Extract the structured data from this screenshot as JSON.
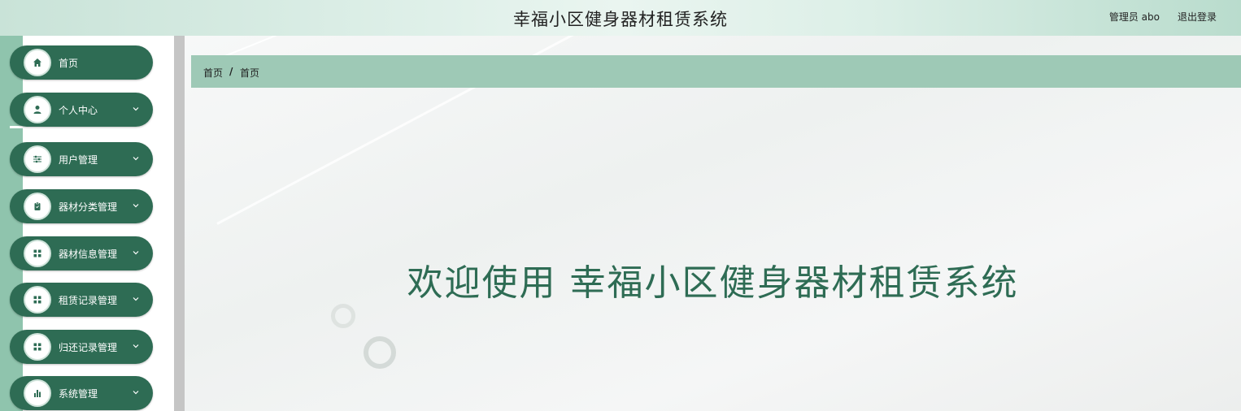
{
  "header": {
    "title": "幸福小区健身器材租赁系统",
    "user_label": "管理员 abo",
    "logout_label": "退出登录"
  },
  "sidebar": {
    "items": [
      {
        "label": "首页",
        "icon": "home-icon",
        "has_chevron": false
      },
      {
        "label": "个人中心",
        "icon": "person-icon",
        "has_chevron": true
      },
      {
        "label": "用户管理",
        "icon": "sliders-icon",
        "has_chevron": true
      },
      {
        "label": "器材分类管理",
        "icon": "clipboard-icon",
        "has_chevron": true
      },
      {
        "label": "器材信息管理",
        "icon": "grid-icon",
        "has_chevron": true
      },
      {
        "label": "租赁记录管理",
        "icon": "grid-icon",
        "has_chevron": true
      },
      {
        "label": "归还记录管理",
        "icon": "grid-icon",
        "has_chevron": true
      },
      {
        "label": "系统管理",
        "icon": "bar-chart-icon",
        "has_chevron": true
      }
    ]
  },
  "breadcrumb": {
    "first": "首页",
    "separator": "/",
    "current": "首页"
  },
  "main": {
    "welcome": "欢迎使用 幸福小区健身器材租赁系统"
  },
  "colors": {
    "accent": "#2e6c54",
    "breadcrumb_bg": "#9ec9b6",
    "sidebar_bg": "#8fc4ad"
  }
}
